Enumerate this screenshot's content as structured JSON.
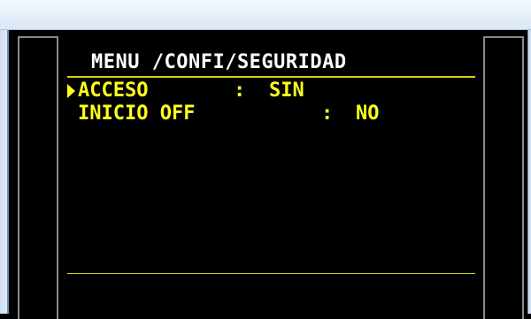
{
  "window": {
    "title": ""
  },
  "menu": {
    "title": "MENU /CONFI/SEGURIDAD",
    "items": [
      {
        "label": "ACCESO",
        "separator": ":",
        "value": "SIN",
        "selected": true
      },
      {
        "label": "INICIO OFF",
        "separator": ":",
        "value": "NO",
        "selected": false
      }
    ]
  },
  "colors": {
    "screen_background": "#000000",
    "title_text": "#ffffff",
    "item_text": "#ffff1a",
    "rule_line": "#d6cf17",
    "panel_border": "#8a8a8a",
    "window_frame": "#cfdff1"
  },
  "icons": {
    "cursor": "triangle-right-icon"
  }
}
